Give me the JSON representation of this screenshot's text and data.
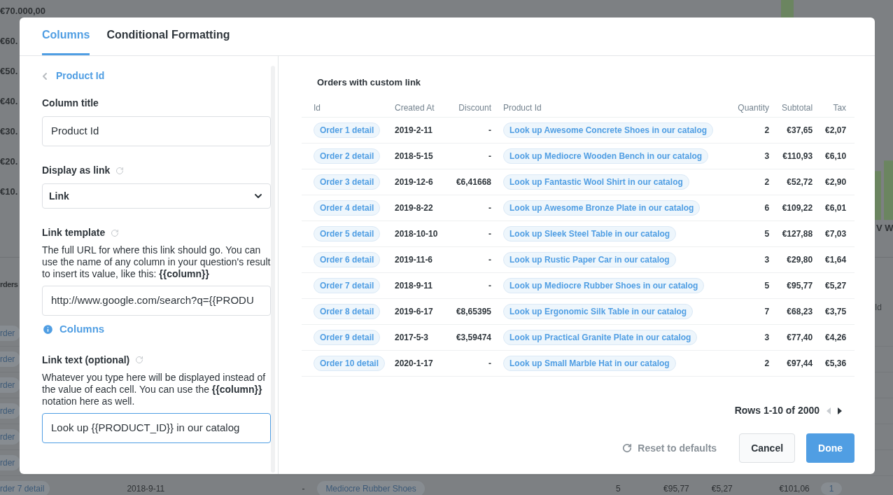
{
  "background": {
    "y_labels": [
      "€70.000,00",
      "€60.",
      "€50.",
      "€40.",
      "€30.",
      "€20.",
      "€10."
    ],
    "x_label": "V W",
    "section_title": "rders",
    "column_label": "Id",
    "rows": [
      {
        "id": "rder"
      },
      {
        "id": "rder"
      },
      {
        "id": "rder"
      },
      {
        "id": "rder"
      },
      {
        "id": "rder"
      },
      {
        "id": "rder"
      },
      {
        "id": "rder 7 detail",
        "created_at": "2018-9-11",
        "discount": "-",
        "product": "Mediocre Rubber Shoes",
        "quantity": "5",
        "subtotal": "€95,77",
        "tax": "€5,27",
        "total": "€101,06",
        "count": "1"
      }
    ]
  },
  "modal": {
    "tabs": [
      {
        "label": "Columns",
        "selected": true
      },
      {
        "label": "Conditional Formatting",
        "selected": false
      }
    ],
    "settings": {
      "back_link": "Product Id",
      "column_title": {
        "label": "Column title",
        "value": "Product Id"
      },
      "display_as_link": {
        "label": "Display as link",
        "value": "Link"
      },
      "link_template": {
        "label": "Link template",
        "help": "The full URL for where this link should go. You can use the name of any column in your question's result to insert its value, like this: **{{column}}**",
        "value": "http://www.google.com/search?q={{PRODU",
        "info_link": "Columns"
      },
      "link_text": {
        "label": "Link text (optional)",
        "help": "Whatever you type here will be displayed instead of the value of each cell. You can use the **{{column}}** notation here as well.",
        "value": "Look up {{PRODUCT_ID}} in our catalog",
        "focused": true
      }
    },
    "preview": {
      "title": "Orders with custom link",
      "columns": [
        "Id",
        "Created At",
        "Discount",
        "Product Id",
        "Quantity",
        "Subtotal",
        "Tax"
      ],
      "rows": [
        [
          "Order 1 detail",
          "2019-2-11",
          "-",
          "Look up Awesome Concrete Shoes in our catalog",
          "2",
          "€37,65",
          "€2,07"
        ],
        [
          "Order 2 detail",
          "2018-5-15",
          "-",
          "Look up Mediocre Wooden Bench in our catalog",
          "3",
          "€110,93",
          "€6,10"
        ],
        [
          "Order 3 detail",
          "2019-12-6",
          "€6,41668",
          "Look up Fantastic Wool Shirt in our catalog",
          "2",
          "€52,72",
          "€2,90"
        ],
        [
          "Order 4 detail",
          "2019-8-22",
          "-",
          "Look up Awesome Bronze Plate in our catalog",
          "6",
          "€109,22",
          "€6,01"
        ],
        [
          "Order 5 detail",
          "2018-10-10",
          "-",
          "Look up Sleek Steel Table in our catalog",
          "5",
          "€127,88",
          "€7,03"
        ],
        [
          "Order 6 detail",
          "2019-11-6",
          "-",
          "Look up Rustic Paper Car in our catalog",
          "3",
          "€29,80",
          "€1,64"
        ],
        [
          "Order 7 detail",
          "2018-9-11",
          "-",
          "Look up Mediocre Rubber Shoes in our catalog",
          "5",
          "€95,77",
          "€5,27"
        ],
        [
          "Order 8 detail",
          "2019-6-17",
          "€8,65395",
          "Look up Ergonomic Silk Table in our catalog",
          "7",
          "€68,23",
          "€3,75"
        ],
        [
          "Order 9 detail",
          "2017-5-3",
          "€3,59474",
          "Look up Practical Granite Plate in our catalog",
          "3",
          "€77,40",
          "€4,26"
        ],
        [
          "Order 10 detail",
          "2020-1-17",
          "-",
          "Look up Small Marble Hat in our catalog",
          "2",
          "€97,44",
          "€5,36"
        ]
      ],
      "pagination": {
        "label": "Rows 1-10 of 2000",
        "prev_disabled": true,
        "next_disabled": false
      }
    },
    "footer": {
      "reset": "Reset to defaults",
      "cancel": "Cancel",
      "done": "Done"
    }
  }
}
